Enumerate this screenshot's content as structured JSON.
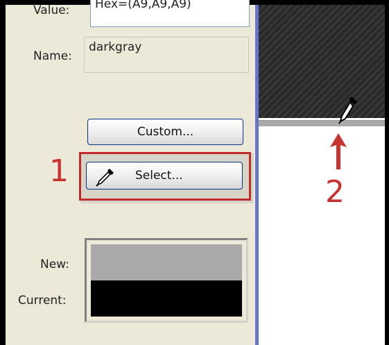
{
  "dialog": {
    "value_label": "Value:",
    "value_text": "Hex=(A9,A9,A9)",
    "name_label": "Name:",
    "name_value": "darkgray",
    "custom_button": "Custom...",
    "select_button": "Select...",
    "new_label": "New:",
    "current_label": "Current:",
    "new_color": "#a9a9a9",
    "current_color": "#000000"
  },
  "annotations": {
    "step1": "1",
    "step2": "2",
    "color": "#c8322f"
  },
  "icons": {
    "eyedropper_button": "eyedropper-icon",
    "eyedropper_cursor": "eyedropper-cursor-icon",
    "arrow": "arrow-up-icon"
  }
}
